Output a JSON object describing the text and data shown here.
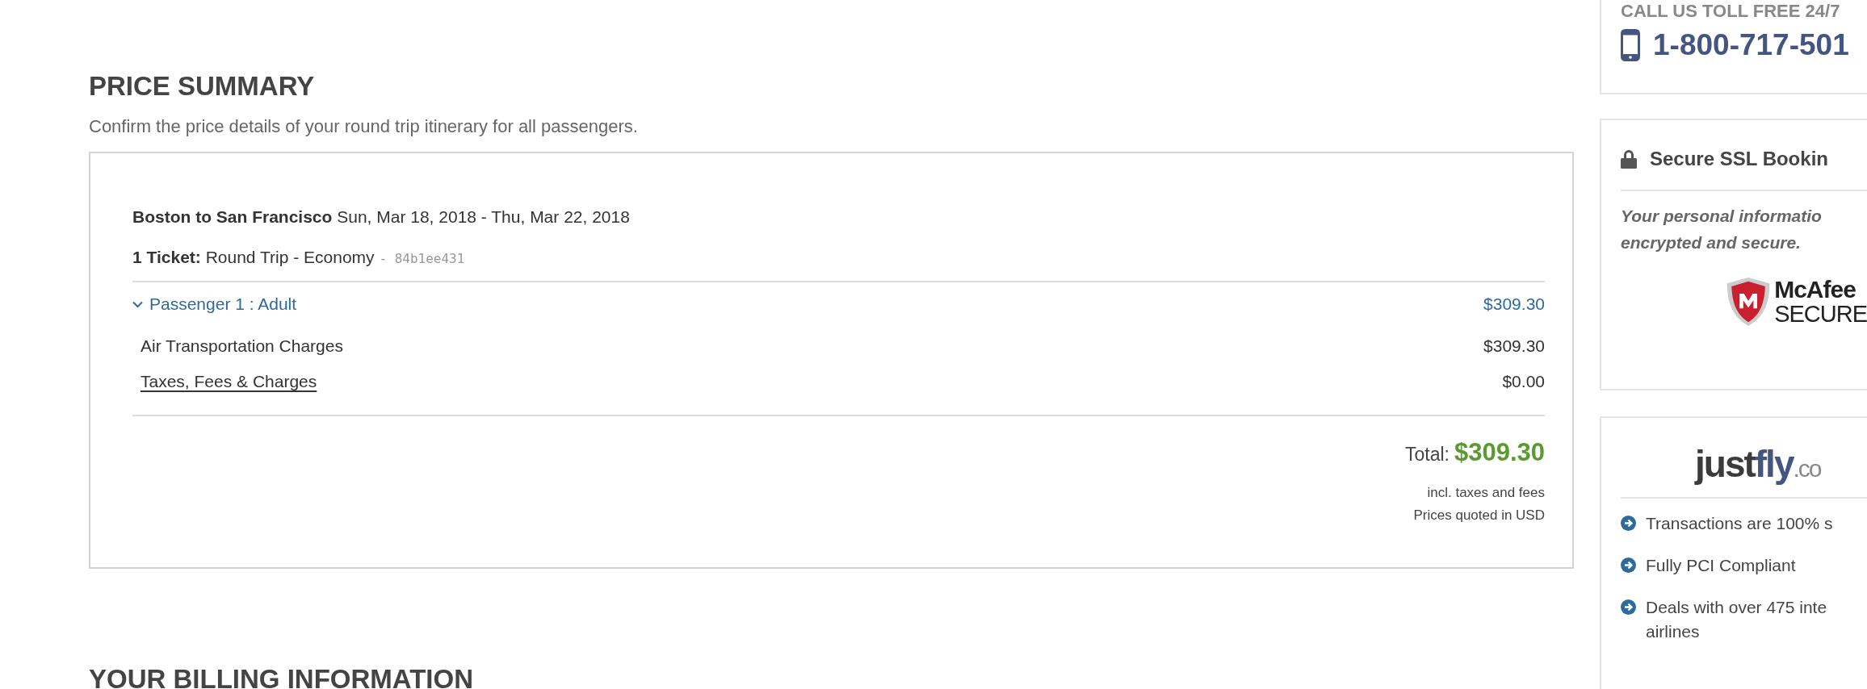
{
  "price_summary": {
    "title": "PRICE SUMMARY",
    "subtitle": "Confirm the price details of your round trip itinerary for all passengers.",
    "route": "Boston to San Francisco",
    "dates": "Sun, Mar 18, 2018 - Thu, Mar 22, 2018",
    "ticket_label": "1 Ticket:",
    "ticket_type": "Round Trip - Economy",
    "ticket_code": "- 84b1ee431",
    "passengers": [
      {
        "label": "Passenger 1 : Adult",
        "amount": "$309.30",
        "expanded": true,
        "charges": [
          {
            "label": "Air Transportation Charges",
            "amount": "$309.30",
            "kind": "plain"
          },
          {
            "label": "Taxes, Fees & Charges",
            "amount": "$0.00",
            "kind": "link"
          }
        ]
      }
    ],
    "total_label": "Total:",
    "total": "$309.30",
    "notes": [
      "incl. taxes and fees",
      "Prices quoted in USD"
    ]
  },
  "next_section": {
    "title": "YOUR BILLING INFORMATION"
  },
  "sidebar": {
    "call": {
      "title": "CALL US TOLL FREE 24/7",
      "phone": "1-800-717-501"
    },
    "secure": {
      "title": "Secure SSL Bookin",
      "text": "Your personal informatio encrypted and secure.",
      "badge": [
        "McAfee",
        "SECURE"
      ]
    },
    "brand": {
      "logo": [
        "just",
        "fly",
        ".co"
      ],
      "items": [
        {
          "lines": [
            "Transactions are 100% s"
          ]
        },
        {
          "lines": [
            "Fully PCI Compliant"
          ]
        },
        {
          "lines": [
            "Deals with over 475 inte",
            "airlines"
          ]
        }
      ]
    }
  }
}
